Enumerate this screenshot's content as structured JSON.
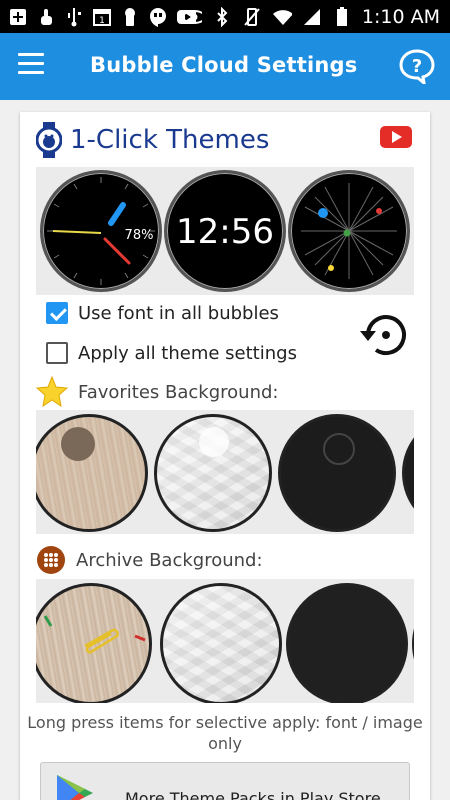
{
  "status_bar": {
    "time": "1:10 AM",
    "icons": [
      "add-icon",
      "touch-icon",
      "usb-icon",
      "calendar-icon",
      "keyhole-icon",
      "hangouts-icon",
      "youtube-icon",
      "eye-icon",
      "bluetooth-icon",
      "vibrate-icon",
      "wifi-icon",
      "signal-icon",
      "battery-icon"
    ],
    "calendar_day": "1"
  },
  "app_bar": {
    "title": "Bubble Cloud Settings",
    "background": "#1e8fe0"
  },
  "themes": {
    "title": "1-Click Themes",
    "title_color": "#1a3a8f",
    "watch_digital_time": "12:56",
    "watch_battery": "78%"
  },
  "options": {
    "use_font_label": "Use font in all bubbles",
    "use_font_checked": true,
    "apply_all_label": "Apply all theme settings",
    "apply_all_checked": false
  },
  "favorites": {
    "label": "Favorites Background:"
  },
  "archive": {
    "label": "Archive Background:"
  },
  "hint": "Long press items for selective apply: font / image only",
  "store_button": {
    "label": "More Theme Packs in Play Store"
  }
}
